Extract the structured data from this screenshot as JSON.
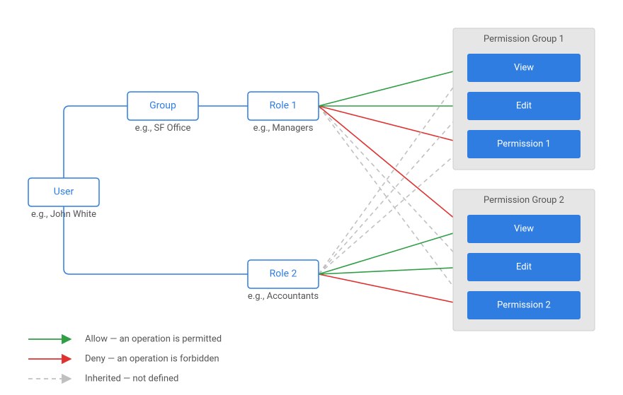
{
  "nodes": {
    "user": {
      "label": "User",
      "caption": "e.g., John White"
    },
    "group": {
      "label": "Group",
      "caption": "e.g., SF Office"
    },
    "role1": {
      "label": "Role 1",
      "caption": "e.g., Managers"
    },
    "role2": {
      "label": "Role 2",
      "caption": "e.g., Accountants"
    }
  },
  "permission_groups": [
    {
      "title": "Permission Group 1",
      "items": [
        "View",
        "Edit",
        "Permission 1"
      ]
    },
    {
      "title": "Permission Group 2",
      "items": [
        "View",
        "Edit",
        "Permission 2"
      ]
    }
  ],
  "legend": {
    "allow": "Allow — an operation is permitted",
    "deny": "Deny — an operation is forbidden",
    "inherited": "Inherited — not defined"
  },
  "colors": {
    "allow": "#2f9e44",
    "deny": "#e03131",
    "inherited": "#c0c0c0",
    "node_stroke": "#2f7de1",
    "perm_fill": "#2f7de1",
    "group_bg": "#e6e6e6"
  },
  "edges": {
    "role1": [
      {
        "target": "g1_view",
        "mode": "allow"
      },
      {
        "target": "g1_edit",
        "mode": "allow"
      },
      {
        "target": "g1_p",
        "mode": "deny"
      },
      {
        "target": "g2_view",
        "mode": "deny"
      },
      {
        "target": "g2_edit",
        "mode": "inherited"
      },
      {
        "target": "g2_p",
        "mode": "inherited"
      }
    ],
    "role2": [
      {
        "target": "g1_view",
        "mode": "inherited"
      },
      {
        "target": "g1_edit",
        "mode": "inherited"
      },
      {
        "target": "g1_p",
        "mode": "inherited"
      },
      {
        "target": "g2_view",
        "mode": "allow"
      },
      {
        "target": "g2_edit",
        "mode": "allow"
      },
      {
        "target": "g2_p",
        "mode": "deny"
      }
    ]
  }
}
